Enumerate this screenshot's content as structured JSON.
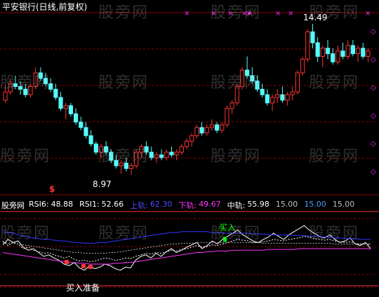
{
  "title": "平安银行(日线,前复权)",
  "watermark": "股旁网",
  "colors": {
    "background": "#000000",
    "up": "#ff3333",
    "down": "#54fcfc",
    "grid": "#8b0000",
    "rsi6": "#ffffff",
    "rsi1": "#ffffff",
    "upper": "#3333ff",
    "lower": "#ff33ff",
    "mid": "#ffffff",
    "level_red": "#ff3333",
    "marker_magenta": "#ff33ff",
    "text_label": "#ffffff",
    "buy_green": "#00ff00"
  },
  "price_panel": {
    "high_label": "14.49",
    "low_label": "8.97",
    "signal_mark": "$"
  },
  "indicator_legend": {
    "name": "股旁网",
    "rsi6_label": "RSI6:",
    "rsi6_value": "48.88",
    "rsi1_label": "RSI1:",
    "rsi1_value": "52.66",
    "upper_label": "上轨:",
    "upper_value": "62.30",
    "lower_label": "下轨:",
    "lower_value": "49.67",
    "mid_label": "中轨:",
    "mid_value": "55.98",
    "extra1": "15.00",
    "extra2": "15.00",
    "extra3": "15.00"
  },
  "annotations": {
    "bottom_text": "买入准备",
    "buy_text": "买入"
  },
  "chart_data": [
    {
      "type": "candlestick",
      "title": "平安银行(日线,前复权)",
      "note": "approximate daily OHLC values read from the price panel",
      "max_label": "14.49",
      "min_label": "8.97",
      "ohlc": [
        [
          11.7,
          12.2,
          11.6,
          12.0
        ],
        [
          12.0,
          12.5,
          11.9,
          12.3
        ],
        [
          12.3,
          12.6,
          12.1,
          12.2
        ],
        [
          12.2,
          12.4,
          11.9,
          12.1
        ],
        [
          12.1,
          12.3,
          11.8,
          11.9
        ],
        [
          11.9,
          12.3,
          11.8,
          12.2
        ],
        [
          12.2,
          12.9,
          12.1,
          12.7
        ],
        [
          12.7,
          12.9,
          12.4,
          12.5
        ],
        [
          12.5,
          12.7,
          12.2,
          12.3
        ],
        [
          12.3,
          12.5,
          12.0,
          12.1
        ],
        [
          12.1,
          12.3,
          11.7,
          11.8
        ],
        [
          11.8,
          12.0,
          11.3,
          11.4
        ],
        [
          11.4,
          11.6,
          11.0,
          11.5
        ],
        [
          11.5,
          11.6,
          11.1,
          11.2
        ],
        [
          11.2,
          11.4,
          10.8,
          10.9
        ],
        [
          10.9,
          11.1,
          10.6,
          10.7
        ],
        [
          10.7,
          10.9,
          10.3,
          10.4
        ],
        [
          10.4,
          10.6,
          10.0,
          10.1
        ],
        [
          10.1,
          10.2,
          9.7,
          9.8
        ],
        [
          9.8,
          10.1,
          9.6,
          10.0
        ],
        [
          10.0,
          10.2,
          9.7,
          9.8
        ],
        [
          9.8,
          9.9,
          9.4,
          9.5
        ],
        [
          9.5,
          9.7,
          9.2,
          9.3
        ],
        [
          9.3,
          9.5,
          9.0,
          9.4
        ],
        [
          9.4,
          9.6,
          9.1,
          9.2
        ],
        [
          9.2,
          9.4,
          8.97,
          9.3
        ],
        [
          9.3,
          9.9,
          9.2,
          9.8
        ],
        [
          9.8,
          10.1,
          9.6,
          10.0
        ],
        [
          10.0,
          10.2,
          9.7,
          9.8
        ],
        [
          9.8,
          10.0,
          9.5,
          9.6
        ],
        [
          9.6,
          9.8,
          9.4,
          9.7
        ],
        [
          9.7,
          9.9,
          9.5,
          9.6
        ],
        [
          9.6,
          9.9,
          9.5,
          9.8
        ],
        [
          9.8,
          10.0,
          9.6,
          9.7
        ],
        [
          9.7,
          9.9,
          9.5,
          9.8
        ],
        [
          9.8,
          10.1,
          9.7,
          10.0
        ],
        [
          10.0,
          10.3,
          9.9,
          10.2
        ],
        [
          10.2,
          10.5,
          10.0,
          10.4
        ],
        [
          10.4,
          10.8,
          10.3,
          10.7
        ],
        [
          10.7,
          10.9,
          10.4,
          10.5
        ],
        [
          10.5,
          10.8,
          10.4,
          10.7
        ],
        [
          10.7,
          11.0,
          10.6,
          10.8
        ],
        [
          10.8,
          10.9,
          10.5,
          10.6
        ],
        [
          10.6,
          10.9,
          10.5,
          10.8
        ],
        [
          10.8,
          11.5,
          10.7,
          11.4
        ],
        [
          11.4,
          11.7,
          11.2,
          11.6
        ],
        [
          11.6,
          12.3,
          11.5,
          12.2
        ],
        [
          12.2,
          12.9,
          12.1,
          12.8
        ],
        [
          12.8,
          13.3,
          12.5,
          12.6
        ],
        [
          12.6,
          12.9,
          12.3,
          12.4
        ],
        [
          12.4,
          12.6,
          12.0,
          12.1
        ],
        [
          12.1,
          12.3,
          11.8,
          11.9
        ],
        [
          11.9,
          12.1,
          11.5,
          11.6
        ],
        [
          11.6,
          11.9,
          11.3,
          11.8
        ],
        [
          11.8,
          12.1,
          11.6,
          11.9
        ],
        [
          11.9,
          12.2,
          11.6,
          11.7
        ],
        [
          11.7,
          12.0,
          11.5,
          11.9
        ],
        [
          11.9,
          12.2,
          11.7,
          12.0
        ],
        [
          12.0,
          12.8,
          11.9,
          12.7
        ],
        [
          12.7,
          13.3,
          12.6,
          13.2
        ],
        [
          13.2,
          14.3,
          13.1,
          14.2
        ],
        [
          14.2,
          14.49,
          13.6,
          13.8
        ],
        [
          13.8,
          14.0,
          13.1,
          13.3
        ],
        [
          13.3,
          13.7,
          12.9,
          13.6
        ],
        [
          13.6,
          13.9,
          13.2,
          13.4
        ],
        [
          13.4,
          13.6,
          13.0,
          13.1
        ],
        [
          13.1,
          13.7,
          13.0,
          13.5
        ],
        [
          13.5,
          13.8,
          13.2,
          13.3
        ],
        [
          13.3,
          13.9,
          13.2,
          13.7
        ],
        [
          13.7,
          13.9,
          13.3,
          13.4
        ],
        [
          13.4,
          13.7,
          13.1,
          13.6
        ],
        [
          13.6,
          13.8,
          13.2,
          13.3
        ],
        [
          13.3,
          13.6,
          13.1,
          13.5
        ]
      ]
    },
    {
      "type": "line",
      "title": "股旁网",
      "ylim": [
        0,
        100
      ],
      "series": [
        {
          "name": "RSI6",
          "values": [
            55,
            62,
            58,
            60,
            52,
            48,
            50,
            45,
            40,
            42,
            38,
            35,
            30,
            28,
            32,
            25,
            22,
            28,
            24,
            26,
            30,
            28,
            24,
            22,
            26,
            25,
            35,
            40,
            42,
            38,
            44,
            40,
            46,
            50,
            45,
            48,
            52,
            55,
            58,
            50,
            54,
            60,
            56,
            62,
            66,
            70,
            74,
            68,
            64,
            60,
            58,
            62,
            65,
            70,
            66,
            62,
            68,
            72,
            76,
            80,
            74,
            70,
            66,
            64,
            68,
            62,
            58,
            60,
            64,
            56,
            54,
            58,
            50
          ]
        },
        {
          "name": "RSI1",
          "values": [
            60,
            54,
            58,
            56,
            50,
            52,
            48,
            46,
            44,
            45,
            42,
            40,
            38,
            40,
            36,
            34,
            35,
            33,
            34,
            36,
            38,
            37,
            35,
            36,
            38,
            37,
            40,
            42,
            44,
            43,
            45,
            44,
            46,
            48,
            47,
            49,
            50,
            52,
            54,
            52,
            53,
            55,
            54,
            56,
            58,
            60,
            62,
            61,
            60,
            58,
            58,
            59,
            60,
            62,
            61,
            60,
            62,
            63,
            64,
            66,
            65,
            63,
            62,
            61,
            62,
            60,
            59,
            58,
            59,
            57,
            56,
            57,
            55
          ]
        },
        {
          "name": "上轨",
          "values": [
            72,
            71,
            70,
            68,
            66,
            65,
            64,
            63,
            62,
            62,
            61,
            60,
            60,
            59,
            58,
            58,
            57,
            57,
            57,
            58,
            58,
            59,
            60,
            61,
            62,
            63,
            64,
            65,
            66,
            67,
            68,
            69,
            70,
            71,
            71,
            72,
            72,
            72,
            72,
            72,
            72,
            71,
            71,
            70,
            70,
            70,
            70,
            70,
            70,
            69,
            69,
            69,
            68,
            68,
            68,
            68,
            68,
            67,
            67,
            67,
            66,
            66,
            66,
            65,
            65,
            64,
            64,
            63,
            63,
            63,
            62,
            62,
            62
          ]
        },
        {
          "name": "下轨",
          "values": [
            45,
            44,
            43,
            42,
            41,
            40,
            39,
            38,
            37,
            36,
            35,
            34,
            33,
            32,
            32,
            31,
            31,
            30,
            30,
            30,
            30,
            30,
            31,
            31,
            32,
            32,
            33,
            34,
            35,
            36,
            37,
            38,
            39,
            40,
            41,
            42,
            43,
            44,
            45,
            45,
            46,
            46,
            47,
            47,
            47,
            48,
            48,
            48,
            48,
            48,
            48,
            48,
            49,
            49,
            49,
            49,
            49,
            49,
            50,
            50,
            50,
            50,
            50,
            50,
            50,
            50,
            50,
            50,
            50,
            50,
            50,
            50,
            49.67
          ]
        },
        {
          "name": "中轨",
          "values": [
            58,
            57,
            57,
            56,
            55,
            54,
            53,
            52,
            51,
            50,
            49,
            48,
            47,
            46,
            45,
            45,
            44,
            44,
            44,
            44,
            44,
            45,
            45,
            46,
            47,
            48,
            49,
            50,
            51,
            52,
            53,
            54,
            55,
            56,
            56,
            57,
            57,
            57,
            58,
            58,
            58,
            58,
            58,
            58,
            58,
            58,
            58,
            58,
            58,
            58,
            58,
            57,
            57,
            57,
            57,
            57,
            57,
            57,
            57,
            57,
            57,
            57,
            57,
            57,
            57,
            56,
            56,
            56,
            56,
            56,
            56,
            56,
            55.98
          ]
        }
      ]
    }
  ]
}
